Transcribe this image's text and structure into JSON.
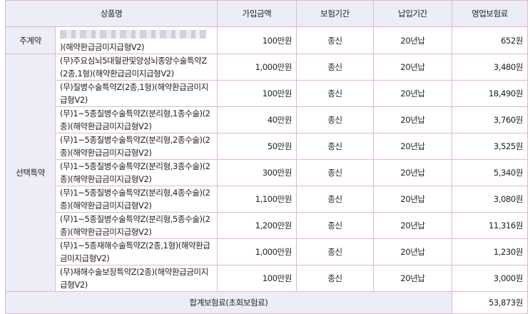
{
  "headers": {
    "product": "상품명",
    "amount": "가입금액",
    "period": "보험기간",
    "payment": "납입기간",
    "premium": "영업보험료"
  },
  "categories": {
    "main": "주계약",
    "rider": "선택특약"
  },
  "main_contract": {
    "name_suffix": ")(해약환급금미지급형V2)",
    "amount": "100만원",
    "period": "종신",
    "payment": "20년납",
    "premium": "652원"
  },
  "riders": [
    {
      "name": "(무)주요심뇌5대혈관및양성뇌종양수술특약Z(2종,1형)(해약환급금미지급형V2)",
      "amount": "1,000만원",
      "period": "종신",
      "payment": "20년납",
      "premium": "3,480원"
    },
    {
      "name": "(무)질병수술특약Z(2종,1형)(해약환급금미지급형V2)",
      "amount": "100만원",
      "period": "종신",
      "payment": "20년납",
      "premium": "18,490원"
    },
    {
      "name": "(무)1~5종질병수술특약Z(분리형,1종수술)(2종)(해약환급금미지급형V2)",
      "amount": "40만원",
      "period": "종신",
      "payment": "20년납",
      "premium": "3,760원"
    },
    {
      "name": "(무)1~5종질병수술특약Z(분리형,2종수술)(2종)(해약환급금미지급형V2)",
      "amount": "50만원",
      "period": "종신",
      "payment": "20년납",
      "premium": "3,525원"
    },
    {
      "name": "(무)1~5종질병수술특약Z(분리형,3종수술)(2종)(해약환급금미지급형V2)",
      "amount": "300만원",
      "period": "종신",
      "payment": "20년납",
      "premium": "5,340원"
    },
    {
      "name": "(무)1~5종질병수술특약Z(분리형,4종수술)(2종)(해약환급금미지급형V2)",
      "amount": "1,100만원",
      "period": "종신",
      "payment": "20년납",
      "premium": "3,080원"
    },
    {
      "name": "(무)1~5종질병수술특약Z(분리형,5종수술)(2종)(해약환급금미지급형V2)",
      "amount": "1,200만원",
      "period": "종신",
      "payment": "20년납",
      "premium": "11,316원"
    },
    {
      "name": "(무)1~5종재해수술특약Z(2종,1형)(해약환급금미지급형V2)",
      "amount": "1,000만원",
      "period": "종신",
      "payment": "20년납",
      "premium": "1,230원"
    },
    {
      "name": "(무)재해수술보장특약Z(2종)(해약환급금미지급형V2)",
      "amount": "100만원",
      "period": "종신",
      "payment": "20년납",
      "premium": "3,000원"
    }
  ],
  "total": {
    "label": "합계보험료(초회보험료)",
    "value": "53,873원"
  }
}
